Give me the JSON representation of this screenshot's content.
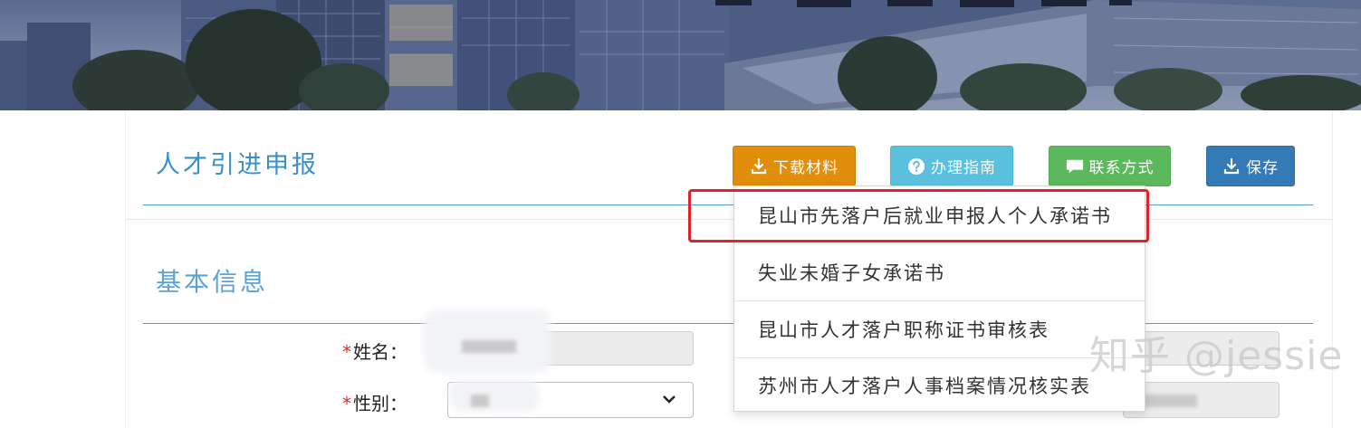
{
  "header": {
    "title": "人才引进申报",
    "buttons": {
      "download": {
        "label": "下载材料",
        "icon": "download-icon",
        "color": "#e08e0b"
      },
      "guide": {
        "label": "办理指南",
        "icon": "question-circle-icon",
        "color": "#5bc0de"
      },
      "contact": {
        "label": "联系方式",
        "icon": "comment-icon",
        "color": "#5cb85c"
      },
      "save": {
        "label": "保存",
        "icon": "save-download-icon",
        "color": "#337ab7"
      }
    }
  },
  "download_menu": {
    "items": [
      "昆山市先落户后就业申报人个人承诺书",
      "失业未婚子女承诺书",
      "昆山市人才落户职称证书审核表",
      "苏州市人才落户人事档案情况核实表"
    ],
    "highlight_color": "#e0222a"
  },
  "form": {
    "section_title": "基本信息",
    "required_mark": "*",
    "fields": {
      "name": {
        "label": "姓名：",
        "value": ""
      },
      "gender": {
        "label": "性别：",
        "value": ""
      }
    }
  },
  "watermark": "知乎 @jessie",
  "colors": {
    "accent": "#3a8fc8",
    "rule": "#4d9fd6",
    "required": "#d9302c"
  }
}
